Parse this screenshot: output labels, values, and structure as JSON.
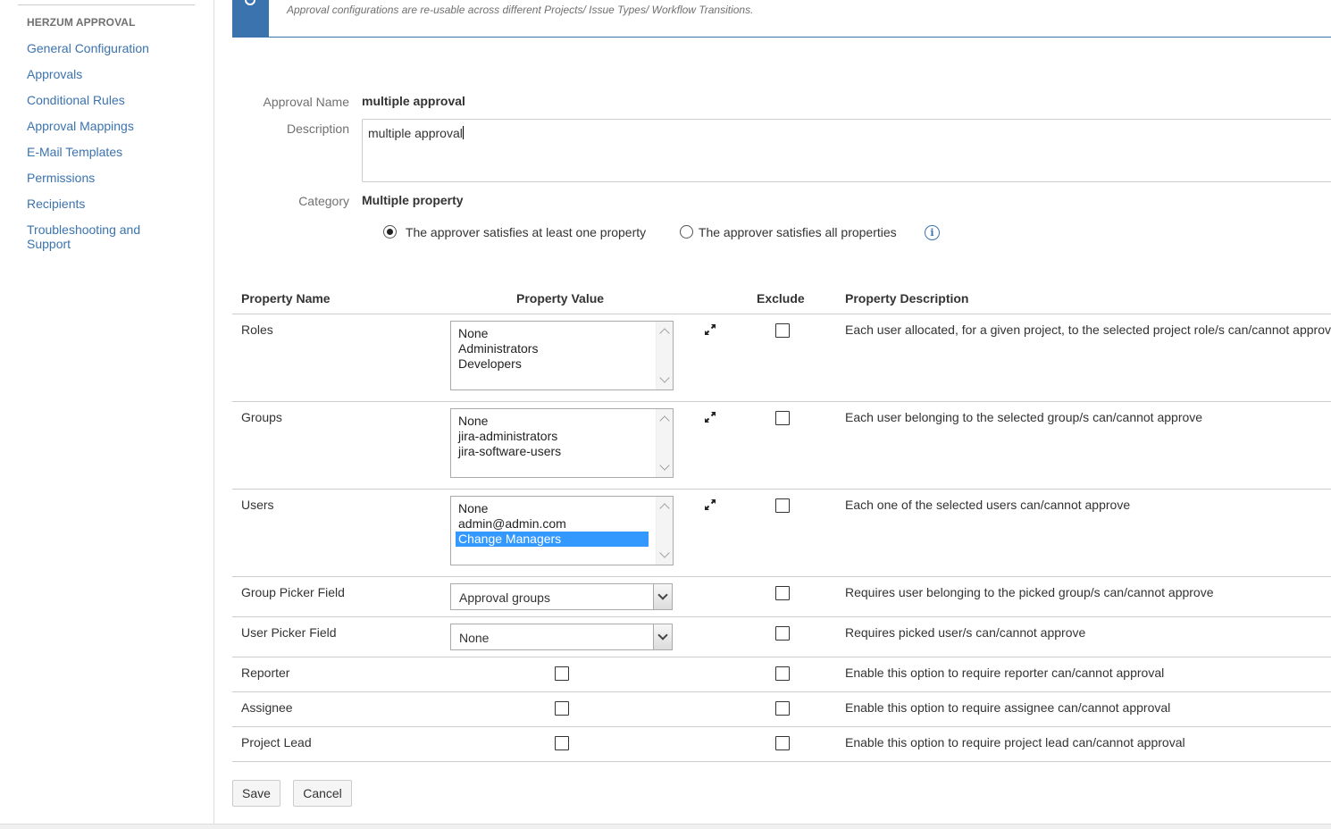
{
  "sidebar": {
    "heading": "HERZUM APPROVAL",
    "items": [
      {
        "label": "General Configuration"
      },
      {
        "label": "Approvals"
      },
      {
        "label": "Conditional Rules"
      },
      {
        "label": "Approval Mappings"
      },
      {
        "label": "E-Mail Templates"
      },
      {
        "label": "Permissions"
      },
      {
        "label": "Recipients"
      },
      {
        "label": "Troubleshooting and",
        "label2": "Support"
      }
    ]
  },
  "banner": {
    "note": "Approval configurations are re-usable across different Projects/ Issue Types/ Workflow Transitions."
  },
  "form": {
    "approval_name_label": "Approval Name",
    "approval_name_value": "multiple approval",
    "description_label": "Description",
    "description_value": "multiple approval",
    "category_label": "Category",
    "category_value": "Multiple property",
    "radio_one_label": "The approver satisfies at least one property",
    "radio_one_selected": true,
    "radio_all_label": "The approver satisfies all properties",
    "radio_all_selected": false,
    "info_icon": "info-icon"
  },
  "table": {
    "headers": {
      "name": "Property Name",
      "value": "Property Value",
      "exclude": "Exclude",
      "description": "Property Description"
    },
    "rows": {
      "roles": {
        "name": "Roles",
        "options": [
          "None",
          "Administrators",
          "Developers"
        ],
        "description": "Each user allocated, for a given project, to the selected project role/s can/cannot approve"
      },
      "groups": {
        "name": "Groups",
        "options": [
          "None",
          "jira-administrators",
          "jira-software-users"
        ],
        "description": "Each user belonging to the selected group/s can/cannot approve"
      },
      "users": {
        "name": "Users",
        "options": [
          "None",
          "admin@admin.com",
          "Change Managers"
        ],
        "selected_option": "Change Managers",
        "description": "Each one of the selected users can/cannot approve"
      },
      "group_picker": {
        "name": "Group Picker Field",
        "selected": "Approval groups",
        "description": "Requires user belonging to the picked group/s can/cannot approve"
      },
      "user_picker": {
        "name": "User Picker Field",
        "selected": "None",
        "description": "Requires picked user/s can/cannot approve"
      },
      "reporter": {
        "name": "Reporter",
        "description": "Enable this option to require reporter can/cannot approval"
      },
      "assignee": {
        "name": "Assignee",
        "description": "Enable this option to require assignee can/cannot approval"
      },
      "project_lead": {
        "name": "Project Lead",
        "description": "Enable this option to require project lead can/cannot approval"
      }
    }
  },
  "buttons": {
    "save": "Save",
    "cancel": "Cancel"
  },
  "colors": {
    "link": "#3b73af",
    "selection": "#3399ff"
  }
}
